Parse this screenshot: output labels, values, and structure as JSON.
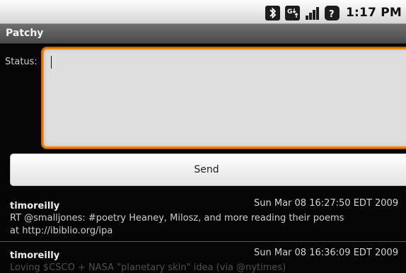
{
  "statusbar": {
    "time": "1:17 PM",
    "icons": [
      "bluetooth-icon",
      "network-g-icon",
      "signal-icon",
      "battery-icon"
    ]
  },
  "app": {
    "title": "Patchy"
  },
  "compose": {
    "label": "Status:",
    "value": "",
    "send_label": "Send",
    "accent_color": "#ff8a00"
  },
  "tweets": [
    {
      "author": "timoreilly",
      "date": "Sun Mar 08 16:27:50 EDT 2009",
      "text_lines": [
        "RT @smalljones:  #poetry Heaney, Milosz, and more reading their poems",
        "at http://ibiblio.org/ipa"
      ]
    },
    {
      "author": "timoreilly",
      "date": "Sun Mar 08 16:36:09 EDT 2009",
      "text_lines": [
        "Loving $CSCO + NASA \"planetary skin\" idea (via @nytimes)"
      ]
    }
  ]
}
